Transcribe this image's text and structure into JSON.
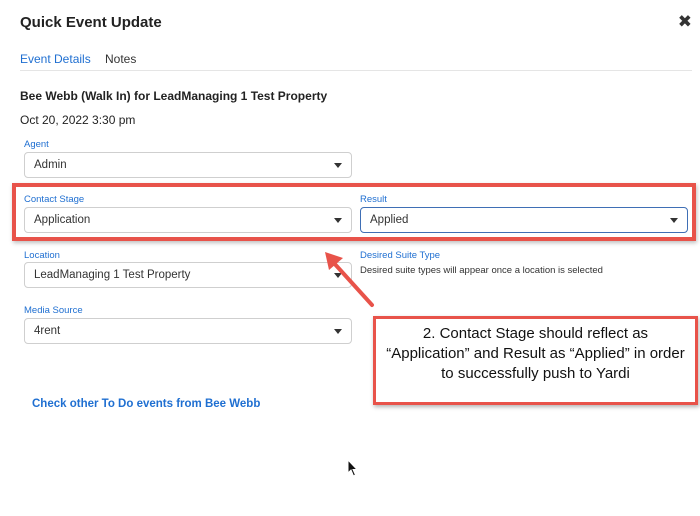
{
  "modal": {
    "title": "Quick Event Update",
    "close_icon": "close-x-icon"
  },
  "tabs": [
    {
      "label": "Event Details",
      "active": true
    },
    {
      "label": "Notes",
      "active": false
    }
  ],
  "event": {
    "contact_title": "Bee Webb (Walk In) for LeadManaging 1 Test Property",
    "date": "Oct 20, 2022 3:30 pm"
  },
  "fields": {
    "agent": {
      "label": "Agent",
      "value": "Admin"
    },
    "contact_stage": {
      "label": "Contact Stage",
      "value": "Application"
    },
    "result": {
      "label": "Result",
      "value": "Applied"
    },
    "location": {
      "label": "Location",
      "value": "LeadManaging 1 Test Property"
    },
    "desired_suite_type": {
      "label": "Desired Suite Type",
      "helper": "Desired suite types will appear once a location is selected"
    },
    "media_source": {
      "label": "Media Source",
      "value": "4rent"
    }
  },
  "link": {
    "other_events": "Check other To Do events from Bee Webb"
  },
  "annotation": {
    "callout_text": "2. Contact Stage should reflect as “Application” and Result as “Applied” in order to successfully push to Yardi",
    "color": "#e8534a"
  },
  "colors": {
    "accent": "#1f6fd1",
    "annotation": "#e8534a"
  }
}
